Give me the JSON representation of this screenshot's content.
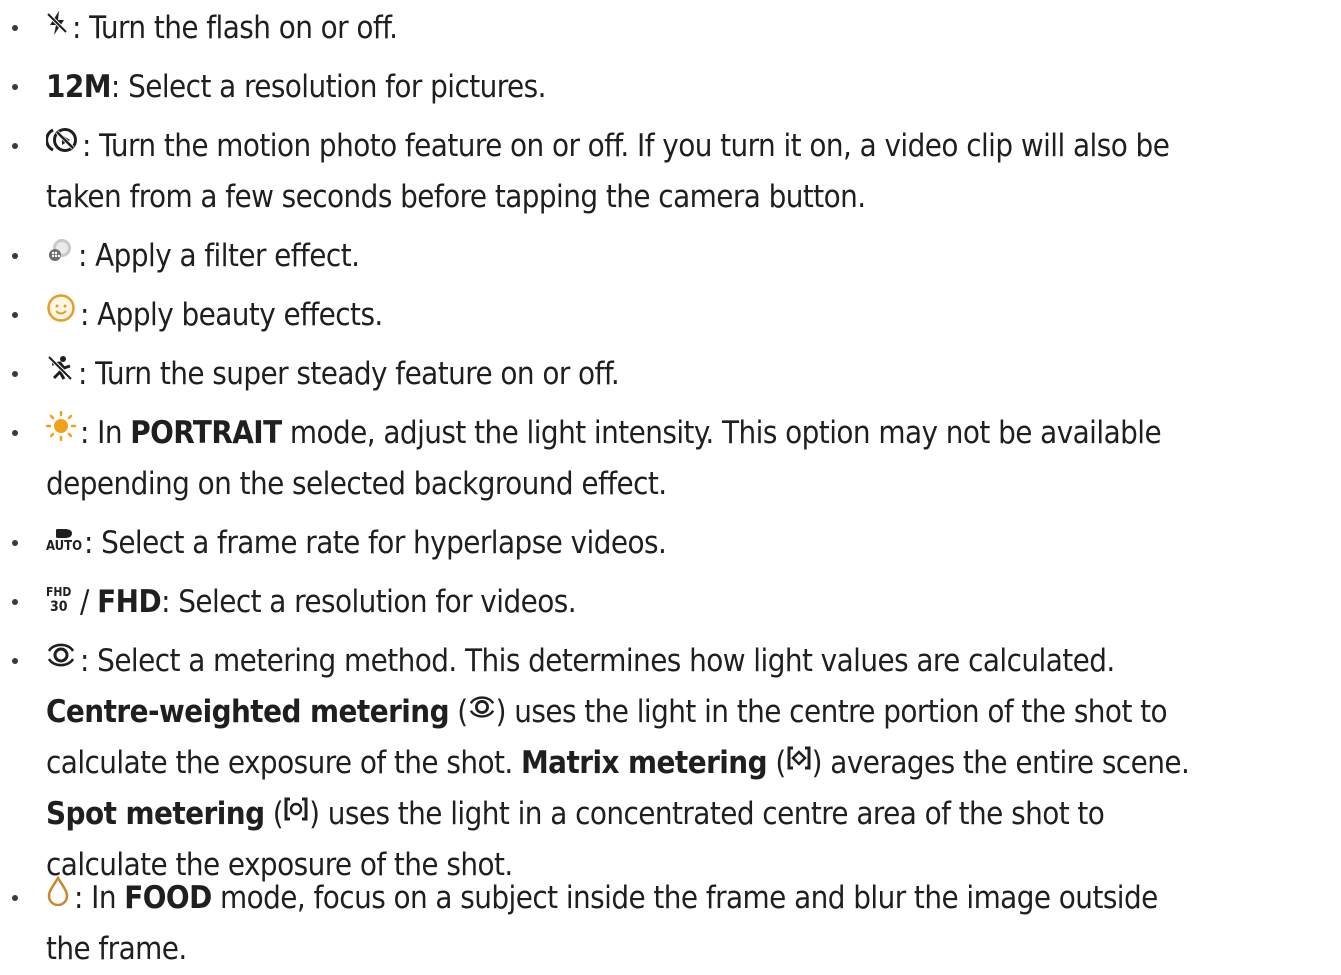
{
  "items": [
    {
      "line1": ": Turn the flash on or off."
    },
    {
      "b1": "12M",
      "line1": ": Select a resolution for pictures."
    },
    {
      "line1": ": Turn the motion photo feature on or off. If you turn it on, a video clip will also be",
      "line2": "taken from a few seconds before tapping the camera button."
    },
    {
      "line1": ": Apply a filter effect."
    },
    {
      "line1": ": Apply beauty effects."
    },
    {
      "line1": ": Turn the super steady feature on or off."
    },
    {
      "pre": ": In ",
      "b1": "PORTRAIT",
      "post": " mode, adjust the light intensity. This option may not be available",
      "line2": "depending on the selected background effect."
    },
    {
      "line1": ": Select a frame rate for hyperlapse videos.",
      "icon_label": "AUTO"
    },
    {
      "sep": "/ ",
      "b1": "FHD",
      "post": ": Select a resolution for videos.",
      "icon_top": "FHD",
      "icon_bottom": "30"
    },
    {
      "line1": ": Select a metering method. This determines how light values are calculated.",
      "l2_b": "Centre-weighted metering",
      "l2_post": " uses the light in the centre portion of the shot to",
      "l3_pre": "calculate the exposure of the shot. ",
      "l3_b": "Matrix metering",
      "l3_post": " averages the entire scene.",
      "l4_b": "Spot metering",
      "l4_post": " uses the light in a concentrated centre area of the shot to",
      "l5": "calculate the exposure of the shot."
    },
    {
      "pre": ": In ",
      "b1": "FOOD",
      "post": " mode, focus on a subject inside the frame and blur the image outside",
      "line2": "the frame."
    }
  ],
  "colors": {
    "text": "#1f1f1f",
    "flash": "#1f1f1f",
    "sun": "#f3a01c",
    "beauty": "#e0a02a",
    "food": "#c8872a"
  }
}
